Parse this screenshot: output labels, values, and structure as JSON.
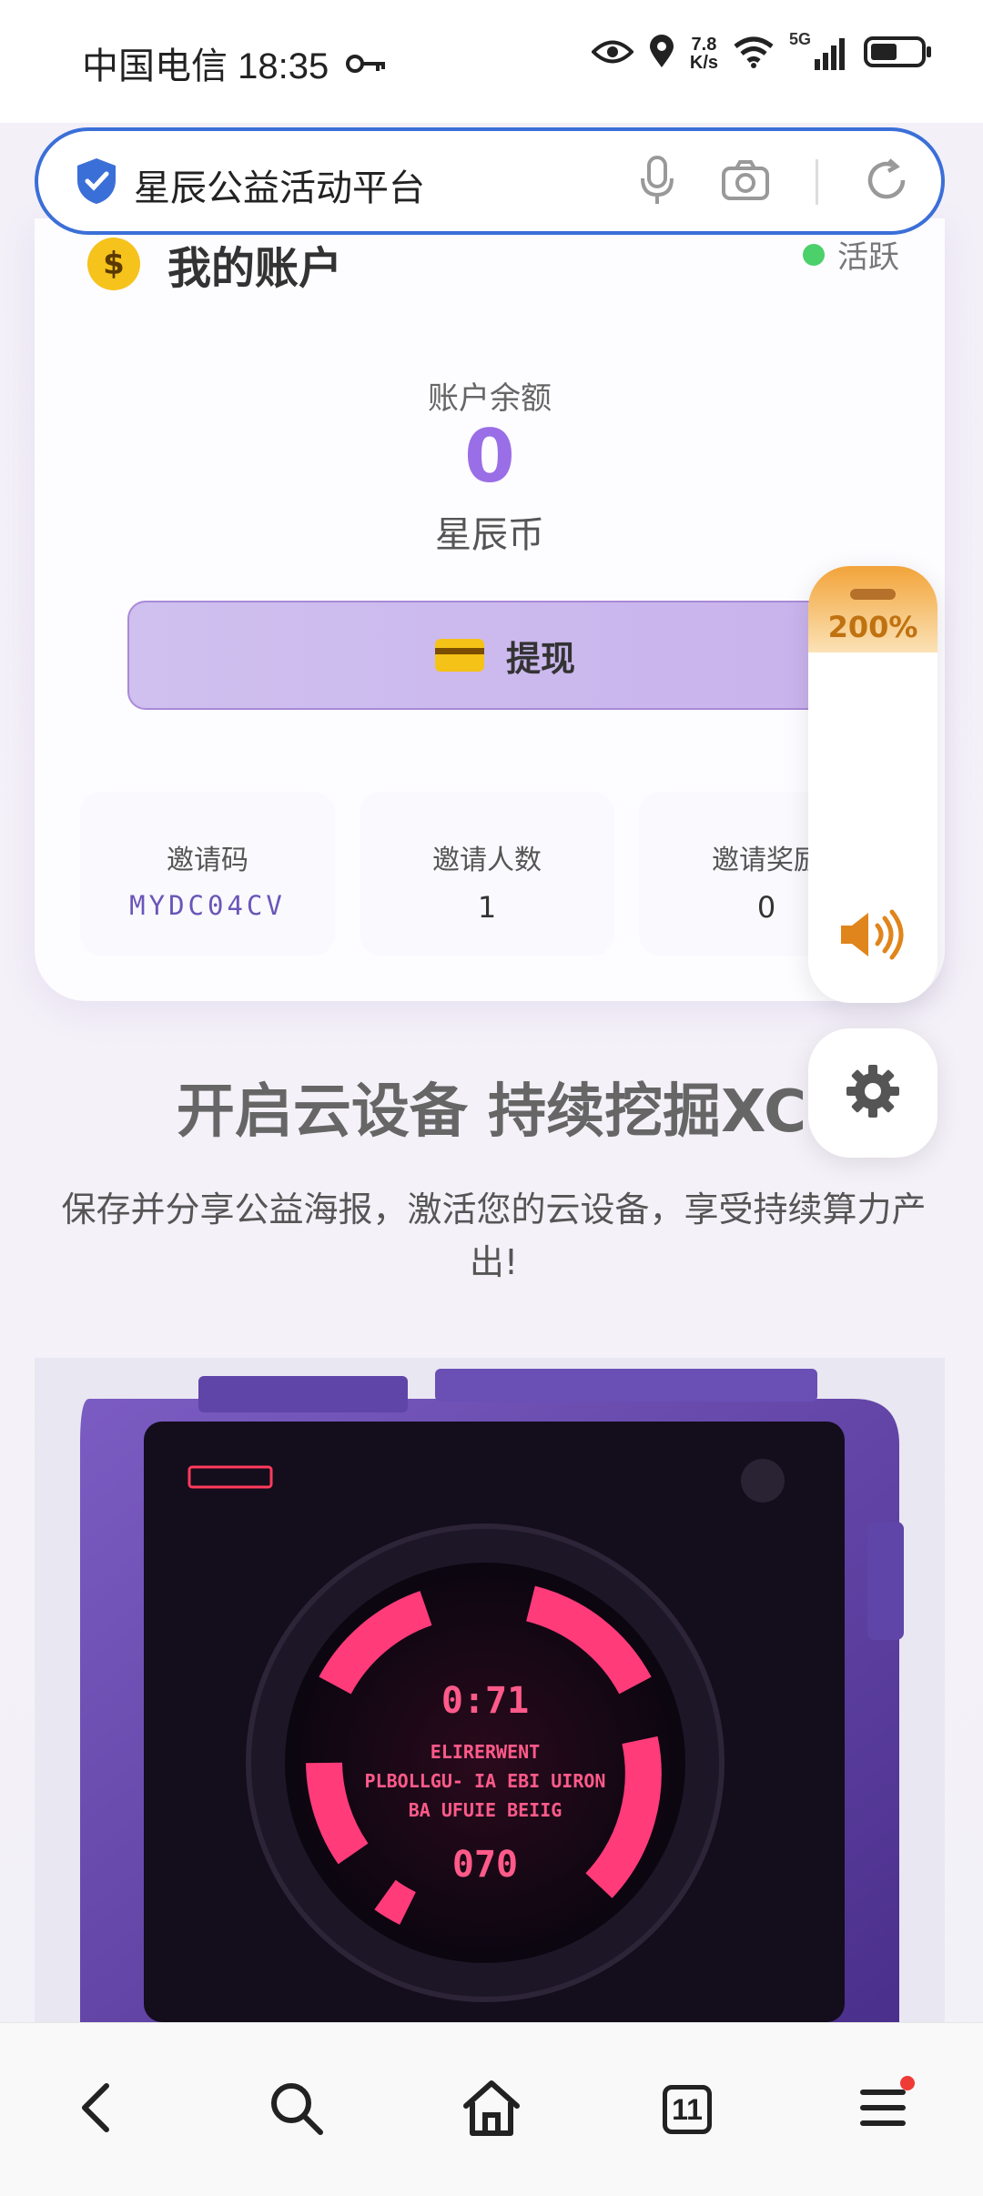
{
  "status_bar": {
    "carrier_time": "中国电信 18:35",
    "net_speed_value": "7.8",
    "net_speed_unit": "K/s",
    "network": "5G",
    "icons": [
      "key-icon",
      "eye-icon",
      "location-icon",
      "wifi-icon",
      "signal-icon",
      "battery-icon"
    ]
  },
  "address_bar": {
    "title": "星辰公益活动平台",
    "icons": [
      "shield-icon",
      "microphone-icon",
      "camera-icon",
      "refresh-icon"
    ]
  },
  "account": {
    "title": "我的账户",
    "status": "活跃",
    "balance_label": "账户余额",
    "balance_value": "0",
    "balance_unit": "星辰币",
    "withdraw_label": "提现",
    "stats": [
      {
        "label": "邀请码",
        "value": "MYDC04CV"
      },
      {
        "label": "邀请人数",
        "value": "1"
      },
      {
        "label": "邀请奖励",
        "value": "0"
      }
    ]
  },
  "volume_widget": {
    "percent": "200%"
  },
  "promo": {
    "title": "开启云设备 持续挖掘XC",
    "description": "保存并分享公益海报，激活您的云设备，享受持续算力产出!"
  },
  "device_image": {
    "display_lines": [
      "0:71",
      "ELIRERWENT",
      "PLBOLLGU- IA EBI UIRON",
      "BA UFUIE BEIIG",
      "070"
    ]
  },
  "bottom_nav": {
    "tab_count": "11",
    "items": [
      "back-icon",
      "search-icon",
      "home-icon",
      "tabs-icon",
      "menu-icon"
    ]
  },
  "colors": {
    "accent_purple": "#9a6ee6",
    "address_border": "#3b6fd8",
    "status_green": "#4cd06a",
    "volume_orange": "#f2a43a",
    "screen_pink": "#ff3b7a"
  }
}
